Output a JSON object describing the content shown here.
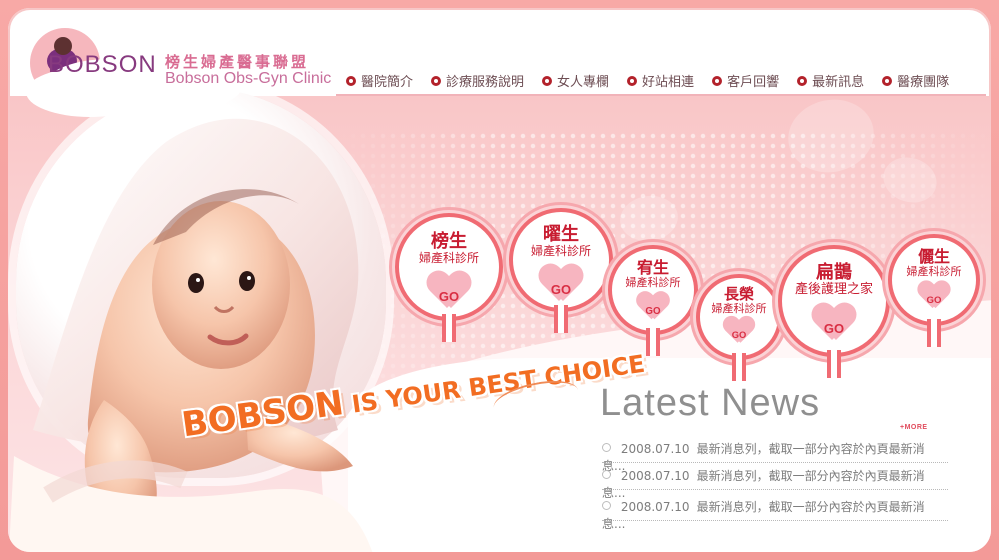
{
  "brand": {
    "logo_text": "BOBSON",
    "name_zh": "榜生婦產醫事聯盟",
    "name_en": "Bobson Obs-Gyn Clinic"
  },
  "menu": {
    "items": [
      "醫院簡介",
      "診療服務說明",
      "女人專欄",
      "好站相連",
      "客戶回響",
      "最新訊息",
      "醫療團隊"
    ]
  },
  "hero": {
    "slogan_main": "BOBSON",
    "slogan_rest": "IS YOUR BEST CHOICE"
  },
  "clinics": [
    {
      "name": "榜生",
      "sub": "婦產科診所",
      "go": "GO"
    },
    {
      "name": "曜生",
      "sub": "婦產科診所",
      "go": "GO"
    },
    {
      "name": "宥生",
      "sub": "婦產科診所",
      "go": "GO"
    },
    {
      "name": "長榮",
      "sub": "婦產科診所",
      "go": "GO"
    },
    {
      "name": "扁鵲",
      "sub": "產後護理之家",
      "go": "GO"
    },
    {
      "name": "儷生",
      "sub": "婦產科診所",
      "go": "GO"
    }
  ],
  "news": {
    "title": "Latest News",
    "more": "+MORE",
    "items": [
      {
        "date": "2008.07.10",
        "text": "最新消息列，截取一部分內容於內頁最新消息..."
      },
      {
        "date": "2008.07.10",
        "text": "最新消息列，截取一部分內容於內頁最新消息..."
      },
      {
        "date": "2008.07.10",
        "text": "最新消息列，截取一部分內容於內頁最新消息..."
      }
    ]
  },
  "colors": {
    "accent": "#f06b73",
    "brand_purple": "#873a7f",
    "menu_bullet": "#b3222b"
  }
}
